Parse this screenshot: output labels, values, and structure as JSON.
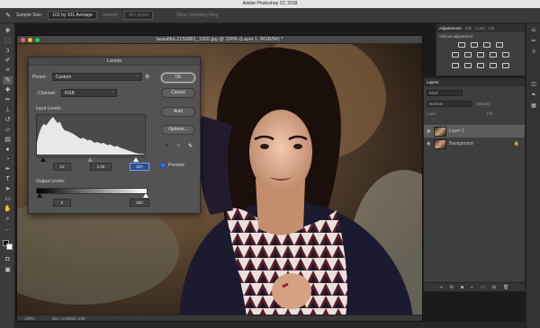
{
  "app": {
    "title": "Adobe Photoshop CC 2018"
  },
  "options_bar": {
    "sample_size_label": "Sample Size:",
    "sample_size_value": "101 by 101 Average",
    "sample_label": "Sample:",
    "sample_value": "All Layers",
    "show_ring_label": "Show Sampling Ring"
  },
  "document": {
    "title": "beautiful-2150881_1920.jpg @ 100% (Layer 1, RGB/8#) *",
    "zoom": "100%",
    "doc_size": "Doc: 3.00M/4.10M"
  },
  "levels": {
    "title": "Levels",
    "preset_label": "Preset:",
    "preset_value": "Custom",
    "channel_label": "Channel:",
    "channel_value": "RGB",
    "input_label": "Input Levels:",
    "input_black": "12",
    "input_gamma": "1.00",
    "input_white": "227",
    "output_label": "Output Levels:",
    "output_black": "0",
    "output_white": "255",
    "ok_label": "OK",
    "cancel_label": "Cancel",
    "auto_label": "Auto",
    "options_label": "Options...",
    "preview_label": "Preview",
    "preview_checked": true,
    "histogram": [
      30,
      55,
      70,
      78,
      74,
      82,
      90,
      96,
      88,
      80,
      84,
      70,
      62,
      60,
      58,
      55,
      52,
      48,
      44,
      40,
      43,
      40,
      36,
      38,
      35,
      30,
      32,
      30,
      28,
      30,
      26,
      24,
      26,
      22,
      20,
      22,
      18,
      16,
      14,
      12,
      10,
      8,
      6,
      4,
      3,
      2,
      2,
      1
    ]
  },
  "adjustments_panel": {
    "tabs": [
      "Adjustments",
      "Info",
      "Color",
      "Lib"
    ],
    "hint": "Add an adjustment"
  },
  "layers_panel": {
    "title": "Layers",
    "kind": "Kind",
    "blend": "Normal",
    "opacity_label": "Opacity:",
    "lock_label": "Lock:",
    "fill_label": "Fill:",
    "layers": [
      {
        "name": "Layer 1",
        "selected": true
      },
      {
        "name": "Background",
        "selected": false
      }
    ]
  }
}
